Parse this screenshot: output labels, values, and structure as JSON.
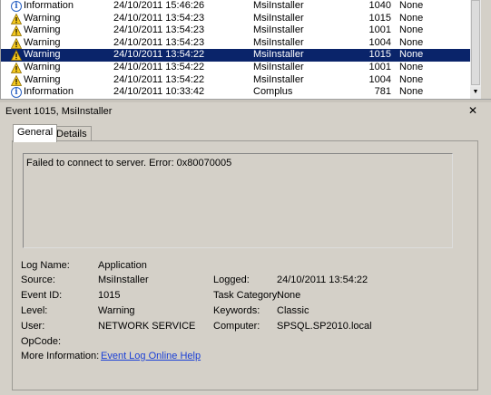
{
  "events": [
    {
      "level": "Information",
      "icon": "info-icon",
      "date": "24/10/2011 15:46:26",
      "source": "MsiInstaller",
      "event_id": "1040",
      "task": "None"
    },
    {
      "level": "Warning",
      "icon": "warning-icon",
      "date": "24/10/2011 13:54:23",
      "source": "MsiInstaller",
      "event_id": "1015",
      "task": "None"
    },
    {
      "level": "Warning",
      "icon": "warning-icon",
      "date": "24/10/2011 13:54:23",
      "source": "MsiInstaller",
      "event_id": "1001",
      "task": "None"
    },
    {
      "level": "Warning",
      "icon": "warning-icon",
      "date": "24/10/2011 13:54:23",
      "source": "MsiInstaller",
      "event_id": "1004",
      "task": "None"
    },
    {
      "level": "Warning",
      "icon": "warning-icon",
      "date": "24/10/2011 13:54:22",
      "source": "MsiInstaller",
      "event_id": "1015",
      "task": "None",
      "selected": true
    },
    {
      "level": "Warning",
      "icon": "warning-icon",
      "date": "24/10/2011 13:54:22",
      "source": "MsiInstaller",
      "event_id": "1001",
      "task": "None"
    },
    {
      "level": "Warning",
      "icon": "warning-icon",
      "date": "24/10/2011 13:54:22",
      "source": "MsiInstaller",
      "event_id": "1004",
      "task": "None"
    },
    {
      "level": "Information",
      "icon": "info-icon",
      "date": "24/10/2011 10:33:42",
      "source": "Complus",
      "event_id": "781",
      "task": "None"
    }
  ],
  "detail": {
    "title": "Event 1015, MsiInstaller",
    "tabs": [
      "General",
      "Details"
    ],
    "message": "Failed to connect to server. Error: 0x80070005",
    "labels": {
      "log_name": "Log Name:",
      "source": "Source:",
      "event_id": "Event ID:",
      "level": "Level:",
      "user": "User:",
      "opcode": "OpCode:",
      "more_info": "More Information:",
      "logged": "Logged:",
      "task_category": "Task Category:",
      "keywords": "Keywords:",
      "computer": "Computer:"
    },
    "values": {
      "log_name": "Application",
      "source": "MsiInstaller",
      "event_id": "1015",
      "level": "Warning",
      "user": "NETWORK SERVICE",
      "opcode": "",
      "more_info_link": "Event Log Online Help",
      "logged": "24/10/2011 13:54:22",
      "task_category": "None",
      "keywords": "Classic",
      "computer": "SPSQL.SP2010.local"
    }
  },
  "colors": {
    "selection": "#0a246a",
    "link": "#1a3fd6",
    "panel": "#d4d0c8"
  }
}
